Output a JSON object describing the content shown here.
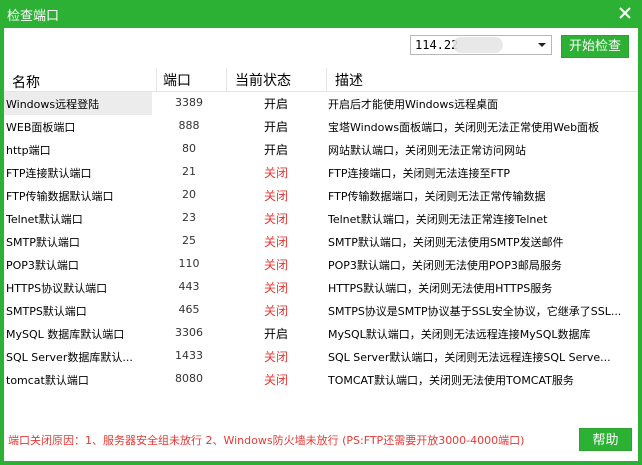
{
  "window": {
    "title": "检查端口"
  },
  "toolbar": {
    "ip_value": "114.22",
    "start_label": "开始检查"
  },
  "table": {
    "headers": [
      "名称",
      "端口",
      "当前状态",
      "描述"
    ],
    "rows": [
      {
        "name": "Windows远程登陆",
        "port": "3389",
        "status": "开启",
        "desc": "开启后才能使用Windows远程桌面",
        "on": true
      },
      {
        "name": "WEB面板端口",
        "port": "888",
        "status": "开启",
        "desc": "宝塔Windows面板端口，关闭则无法正常使用Web面板",
        "on": true
      },
      {
        "name": "http端口",
        "port": "80",
        "status": "开启",
        "desc": "网站默认端口，关闭则无法正常访问网站",
        "on": true
      },
      {
        "name": "FTP连接默认端口",
        "port": "21",
        "status": "关闭",
        "desc": "FTP连接端口，关闭则无法连接至FTP",
        "on": false
      },
      {
        "name": "FTP传输数据默认端口",
        "port": "20",
        "status": "关闭",
        "desc": "FTP传输数据端口，关闭则无法正常传输数据",
        "on": false
      },
      {
        "name": "Telnet默认端口",
        "port": "23",
        "status": "关闭",
        "desc": "Telnet默认端口，关闭则无法正常连接Telnet",
        "on": false
      },
      {
        "name": "SMTP默认端口",
        "port": "25",
        "status": "关闭",
        "desc": "SMTP默认端口，关闭则无法使用SMTP发送邮件",
        "on": false
      },
      {
        "name": "POP3默认端口",
        "port": "110",
        "status": "关闭",
        "desc": "POP3默认端口，关闭则无法使用POP3邮局服务",
        "on": false
      },
      {
        "name": "HTTPS协议默认端口",
        "port": "443",
        "status": "关闭",
        "desc": "HTTPS默认端口，关闭则无法使用HTTPS服务",
        "on": false
      },
      {
        "name": "SMTPS默认端口",
        "port": "465",
        "status": "关闭",
        "desc": "SMTPS协议是SMTP协议基于SSL安全协议，它继承了SSL...",
        "on": false
      },
      {
        "name": "MySQL 数据库默认端口",
        "port": "3306",
        "status": "开启",
        "desc": "MySQL默认端口，关闭则无法远程连接MySQL数据库",
        "on": true
      },
      {
        "name": "SQL Server数据库默认...",
        "port": "1433",
        "status": "关闭",
        "desc": "SQL Server默认端口，关闭则无法远程连接SQL Serve...",
        "on": false
      },
      {
        "name": "tomcat默认端口",
        "port": "8080",
        "status": "关闭",
        "desc": "TOMCAT默认端口，关闭则无法使用TOMCAT服务",
        "on": false
      }
    ]
  },
  "footer": {
    "reason": "端口关闭原因：1、服务器安全组未放行  2、Windows防火墙未放行  (PS:FTP还需要开放3000-4000端口)",
    "help_label": "帮助"
  },
  "colors": {
    "accent": "#2cb134",
    "off": "#e53935"
  },
  "icons": {
    "close": "close-icon",
    "dropdown": "chevron-down-icon"
  }
}
